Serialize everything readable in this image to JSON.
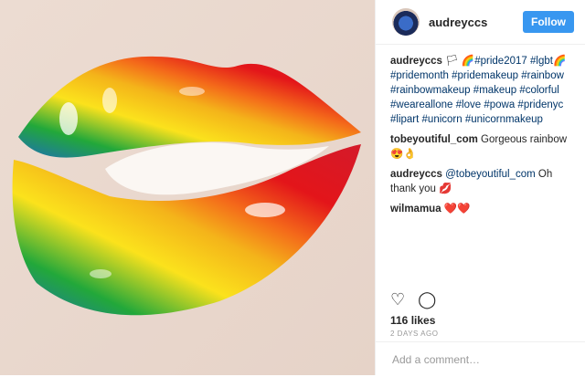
{
  "post": {
    "author": "audreyccs",
    "follow_label": "Follow"
  },
  "comments": [
    {
      "user": "audreyccs",
      "segments": [
        {
          "type": "text",
          "text": "🏳 🌈"
        },
        {
          "type": "tag",
          "text": "#pride2017"
        },
        {
          "type": "text",
          "text": " "
        },
        {
          "type": "tag",
          "text": "#lgbt"
        },
        {
          "type": "text",
          "text": "🌈 "
        },
        {
          "type": "tag",
          "text": "#pridemonth"
        },
        {
          "type": "text",
          "text": " "
        },
        {
          "type": "tag",
          "text": "#pridemakeup"
        },
        {
          "type": "text",
          "text": " "
        },
        {
          "type": "tag",
          "text": "#rainbow"
        },
        {
          "type": "text",
          "text": " "
        },
        {
          "type": "tag",
          "text": "#rainbowmakeup"
        },
        {
          "type": "text",
          "text": " "
        },
        {
          "type": "tag",
          "text": "#makeup"
        },
        {
          "type": "text",
          "text": " "
        },
        {
          "type": "tag",
          "text": "#colorful"
        },
        {
          "type": "text",
          "text": " "
        },
        {
          "type": "tag",
          "text": "#weareallone"
        },
        {
          "type": "text",
          "text": " "
        },
        {
          "type": "tag",
          "text": "#love"
        },
        {
          "type": "text",
          "text": " "
        },
        {
          "type": "tag",
          "text": "#powa"
        },
        {
          "type": "text",
          "text": " "
        },
        {
          "type": "tag",
          "text": "#pridenyc"
        },
        {
          "type": "text",
          "text": " "
        },
        {
          "type": "tag",
          "text": "#lipart"
        },
        {
          "type": "text",
          "text": " "
        },
        {
          "type": "tag",
          "text": "#unicorn"
        },
        {
          "type": "text",
          "text": " "
        },
        {
          "type": "tag",
          "text": "#unicornmakeup"
        }
      ]
    },
    {
      "user": "tobeyoutiful_com",
      "segments": [
        {
          "type": "text",
          "text": "Gorgeous rainbow 😍👌"
        }
      ]
    },
    {
      "user": "audreyccs",
      "segments": [
        {
          "type": "tag",
          "text": "@tobeyoutiful_com"
        },
        {
          "type": "text",
          "text": " Oh thank you 💋"
        }
      ]
    },
    {
      "user": "wilmamua",
      "segments": [
        {
          "type": "text",
          "text": "❤️❤️"
        }
      ]
    }
  ],
  "actions": {
    "like_icon": "heart-icon",
    "comment_icon": "comment-icon"
  },
  "likes_text": "116 likes",
  "time_ago": "2 DAYS AGO",
  "add_comment": {
    "placeholder": "Add a comment…"
  },
  "colors": {
    "follow_blue": "#3897f0",
    "hashtag": "#003569",
    "rainbow": [
      "#e3151a",
      "#f46a1a",
      "#fbe21c",
      "#22a83a",
      "#1d6fb5"
    ]
  }
}
